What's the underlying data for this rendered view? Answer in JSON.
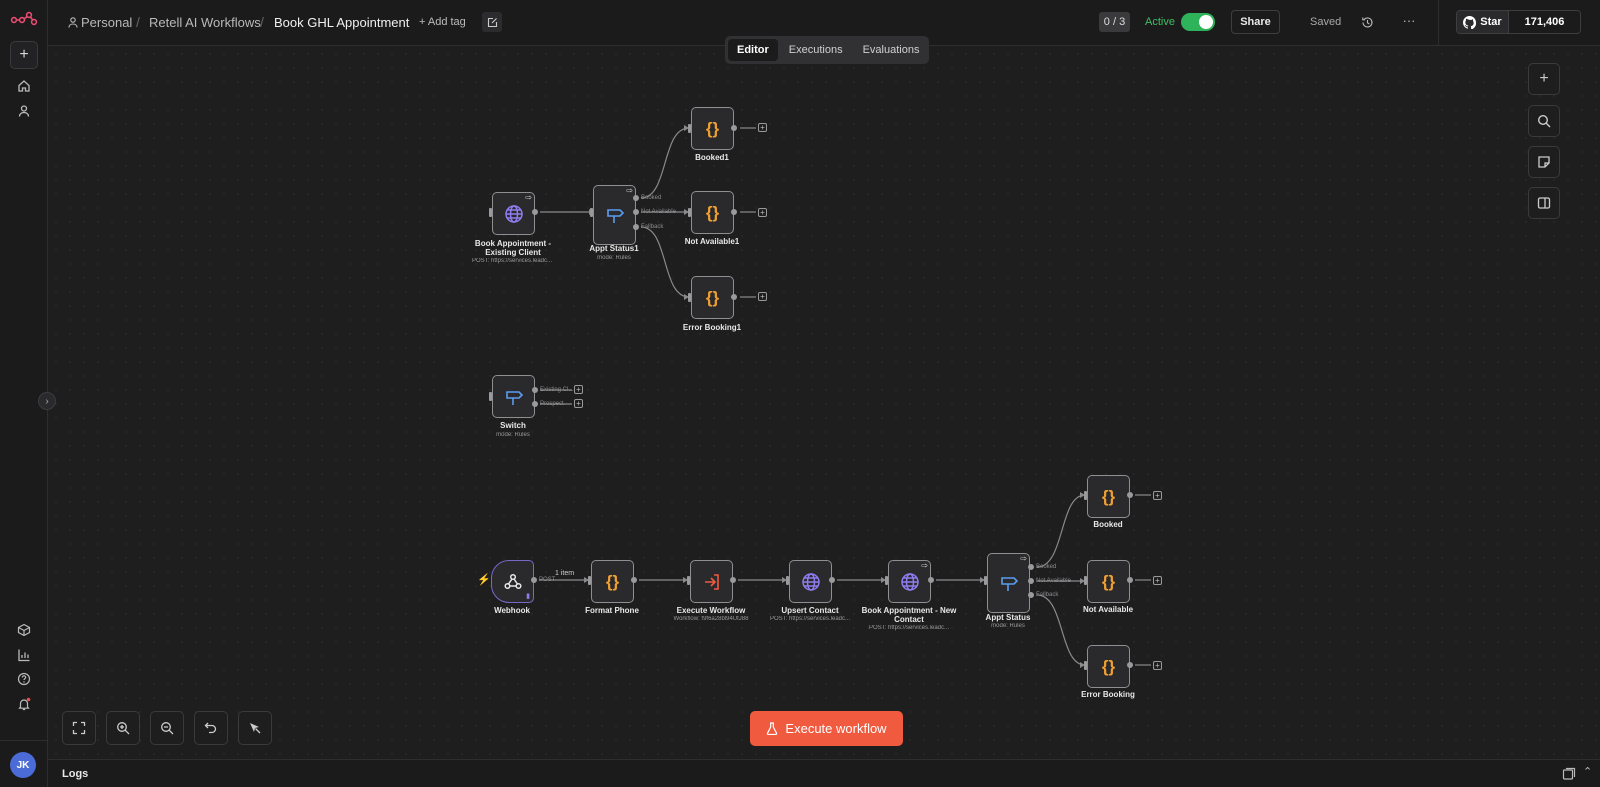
{
  "header": {
    "breadcrumbs": [
      "Personal",
      "Retell AI Workflows",
      "Book GHL Appointment"
    ],
    "add_tag": "+ Add tag",
    "counter": "0 / 3",
    "active_label": "Active",
    "share": "Share",
    "saved": "Saved",
    "github_star": "Star",
    "github_count": "171,406"
  },
  "tabs": [
    {
      "label": "Editor",
      "active": true
    },
    {
      "label": "Executions",
      "active": false
    },
    {
      "label": "Evaluations",
      "active": false
    }
  ],
  "nodes": {
    "book_existing": {
      "label": "Book Appointment - Existing Client",
      "sub": "POST: https://services.leadc..."
    },
    "appt_status1": {
      "label": "Appt Status1",
      "sub": "mode: Rules",
      "outputs": [
        "Booked",
        "Not Available",
        "Fallback"
      ]
    },
    "booked1": {
      "label": "Booked1"
    },
    "not_available1": {
      "label": "Not Available1"
    },
    "error_booking1": {
      "label": "Error Booking1"
    },
    "switch": {
      "label": "Switch",
      "sub": "mode: Rules",
      "outputs": [
        "Existing Cl...",
        "Prospect"
      ]
    },
    "webhook": {
      "label": "Webhook",
      "output": "POST",
      "items_hint": "1 item"
    },
    "format_phone": {
      "label": "Format Phone"
    },
    "execute_workflow": {
      "label": "Execute Workflow",
      "sub": "Workflow: f9f6a28bl94UtJ88"
    },
    "upsert_contact": {
      "label": "Upsert Contact",
      "sub": "POST: https://services.leadc..."
    },
    "book_new": {
      "label": "Book Appointment - New Contact",
      "sub": "POST: https://services.leadc..."
    },
    "appt_status": {
      "label": "Appt Status",
      "sub": "mode: Rules",
      "outputs": [
        "Booked",
        "Not Available",
        "Fallback"
      ]
    },
    "booked": {
      "label": "Booked"
    },
    "not_available": {
      "label": "Not Available"
    },
    "error_booking": {
      "label": "Error Booking"
    }
  },
  "execute_button": "Execute workflow",
  "logs_label": "Logs",
  "user_initials": "JK",
  "colors": {
    "accent": "#f05a3f",
    "active_green": "#2fb35a",
    "code_orange": "#f0a030",
    "http_purple": "#8f7df0",
    "switch_blue": "#5b9df0"
  }
}
